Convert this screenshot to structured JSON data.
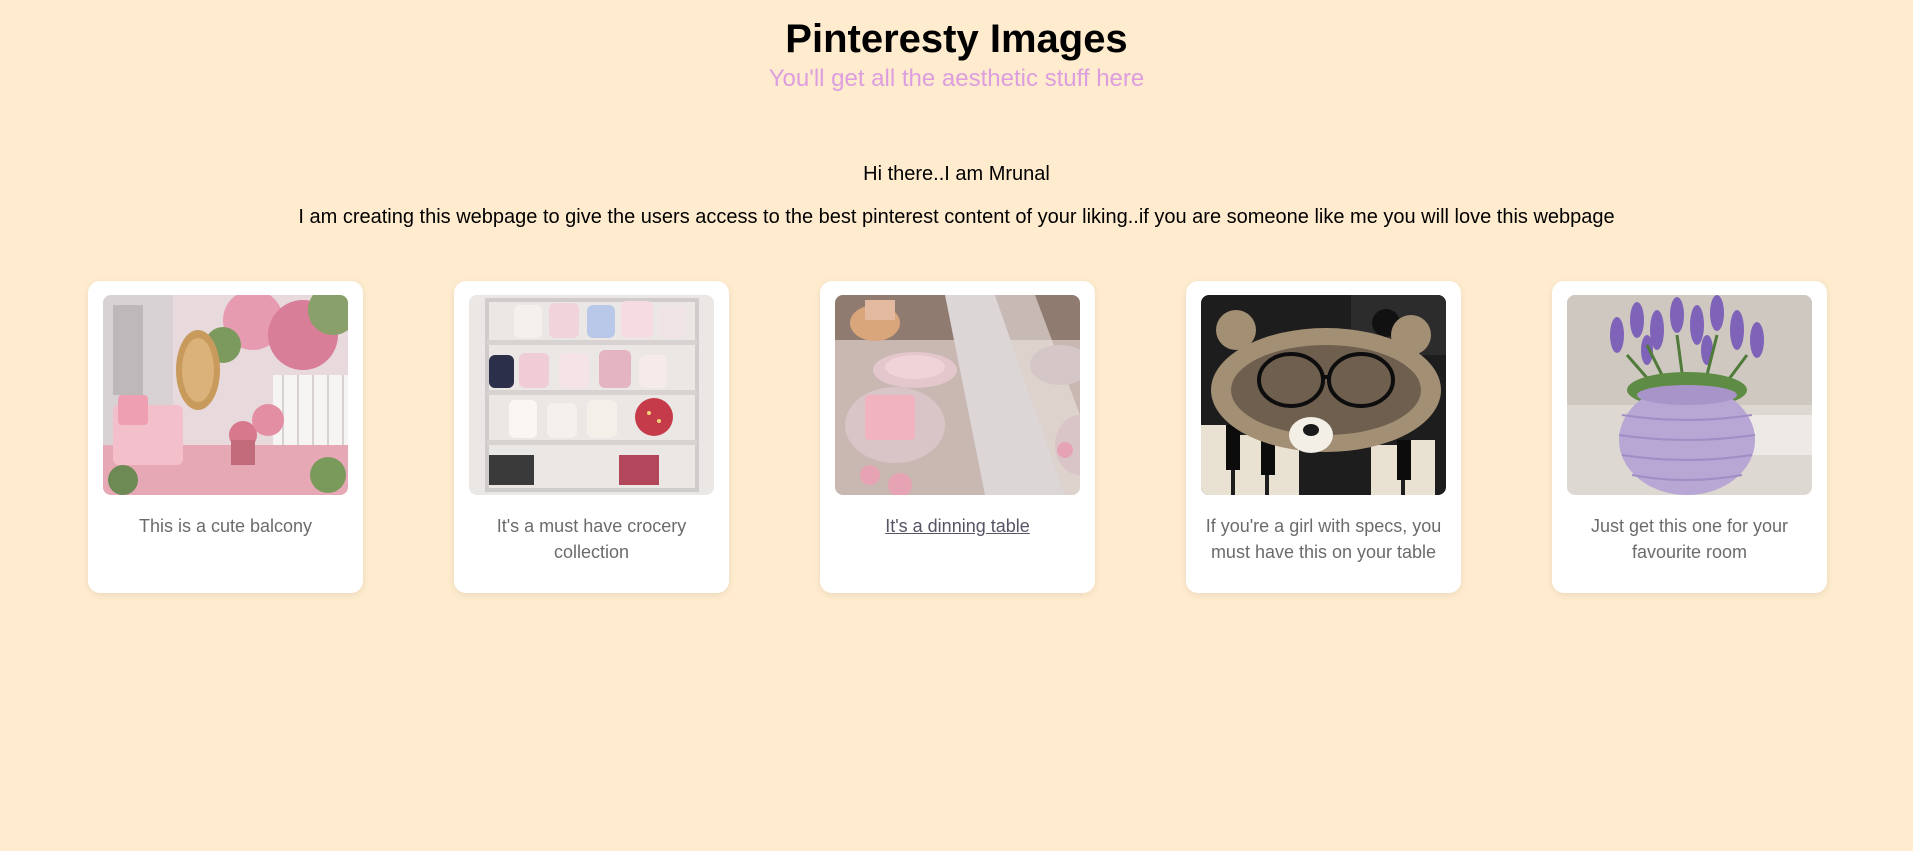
{
  "header": {
    "title": "Pinteresty Images",
    "subtitle": "You'll get all the aesthetic stuff here"
  },
  "intro": {
    "greeting": "Hi there..I am Mrunal",
    "description": "I am creating this webpage to give the users access to the best pinterest content of your liking..if you are someone like me you will love this webpage"
  },
  "colors": {
    "background": "#ffebcd",
    "subtitle": "#dd9ee0",
    "card": "#ffffff",
    "caption": "#6b6b6b"
  },
  "cards": [
    {
      "caption": "This is a cute balcony",
      "image": "pink-balcony-image"
    },
    {
      "caption": "It's a must have crocery collection",
      "image": "mug-shelf-image"
    },
    {
      "caption": "It's a dinning table",
      "image": "dining-table-image"
    },
    {
      "caption": "If you're a girl with specs, you must have this on your table",
      "image": "crochet-bear-glasses-image"
    },
    {
      "caption": "Just get this one for your favourite room",
      "image": "crochet-lavender-vase-image"
    }
  ]
}
